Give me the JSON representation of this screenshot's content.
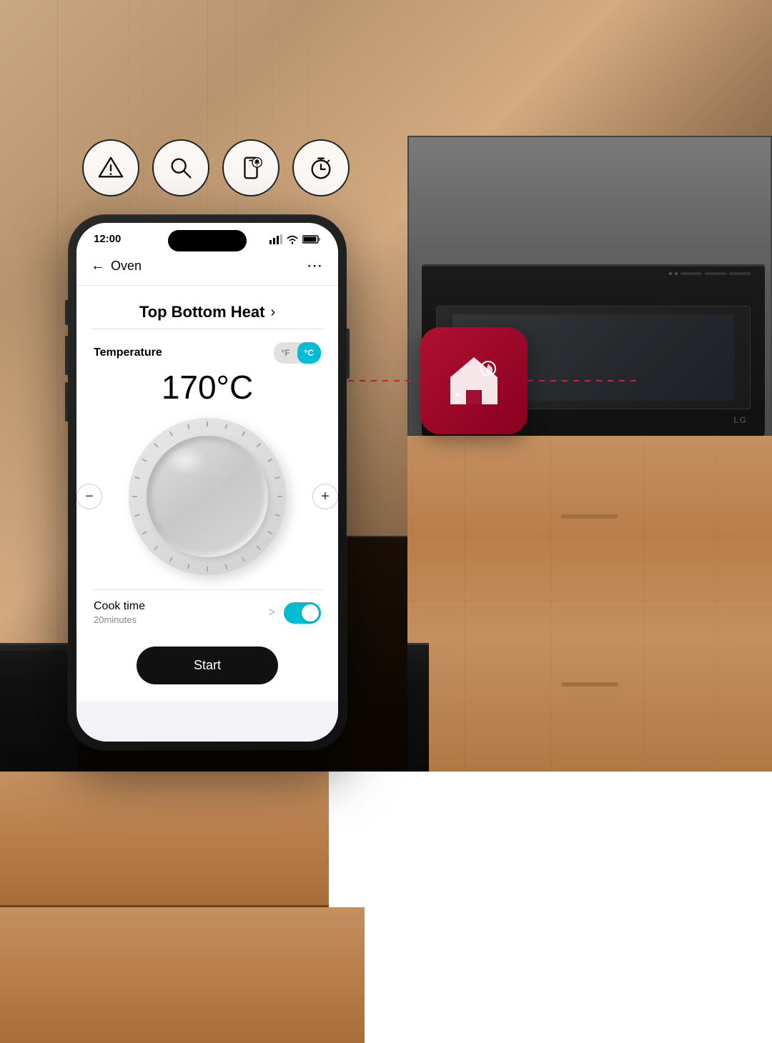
{
  "background": {
    "alt": "Modern kitchen with built-in LG oven"
  },
  "floating_icons": [
    {
      "id": "alert-icon",
      "label": "Alert",
      "symbol": "warning"
    },
    {
      "id": "search-icon",
      "label": "Search",
      "symbol": "search"
    },
    {
      "id": "notification-icon",
      "label": "Smart Notification",
      "symbol": "phone-alert"
    },
    {
      "id": "timer-icon",
      "label": "Timer",
      "symbol": "timer"
    }
  ],
  "smart_home": {
    "icon_label": "LG Smart Home",
    "brand_color": "#a01030"
  },
  "phone": {
    "status_bar": {
      "time": "12:00",
      "signal": "●●●",
      "wifi": "wifi",
      "battery": "battery"
    },
    "header": {
      "back_arrow": "←",
      "title": "Oven",
      "more_menu": "⋯"
    },
    "mode": {
      "label": "Top Bottom Heat",
      "arrow": "›"
    },
    "temperature": {
      "label": "Temperature",
      "unit_f": "°F",
      "unit_c": "°C",
      "active_unit": "c",
      "value": "170°C"
    },
    "dial": {
      "minus_label": "−",
      "plus_label": "+"
    },
    "cook_time": {
      "label": "Cook time",
      "duration": "20minutes",
      "arrow": ">",
      "toggle_on": true
    },
    "start_button": {
      "label": "Start"
    }
  }
}
